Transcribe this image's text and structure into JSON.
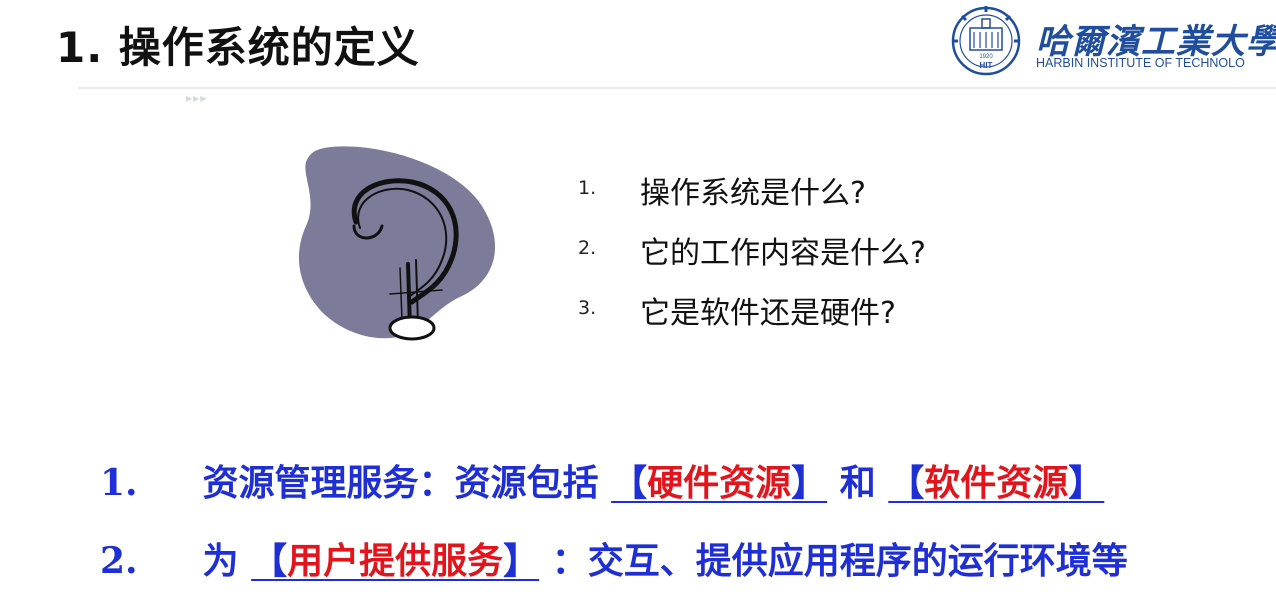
{
  "header": {
    "title": "1. 操作系统的定义",
    "logo": {
      "name_cn": "哈爾濱工業大學(",
      "name_en": "HARBIN INSTITUTE OF TECHNOLO",
      "seal_text": "HIT",
      "seal_year": "1920"
    },
    "arrows": "▶▶▶"
  },
  "questions": [
    {
      "num": "1.",
      "text": "操作系统是什么?"
    },
    {
      "num": "2.",
      "text": "它的工作内容是什么?"
    },
    {
      "num": "3.",
      "text": "它是软件还是硬件?"
    }
  ],
  "answers": [
    {
      "num": "1.",
      "lead": "资源管理服务：资源包括",
      "open1": "【",
      "red1": "硬件资源",
      "close1": "】",
      "mid": "和",
      "open2": "【",
      "red2": "软件资源",
      "close2": "】"
    },
    {
      "num": "2.",
      "lead": "为",
      "open": "【",
      "red": "用户提供服务",
      "close": "】",
      "tail": "：交互、提供应用程序的运行环境等"
    }
  ],
  "colors": {
    "blue_text": "#1f2fd6",
    "red_text": "#e3141b",
    "logo_blue": "#1f4e9e",
    "blob": "#7c7c9a"
  }
}
